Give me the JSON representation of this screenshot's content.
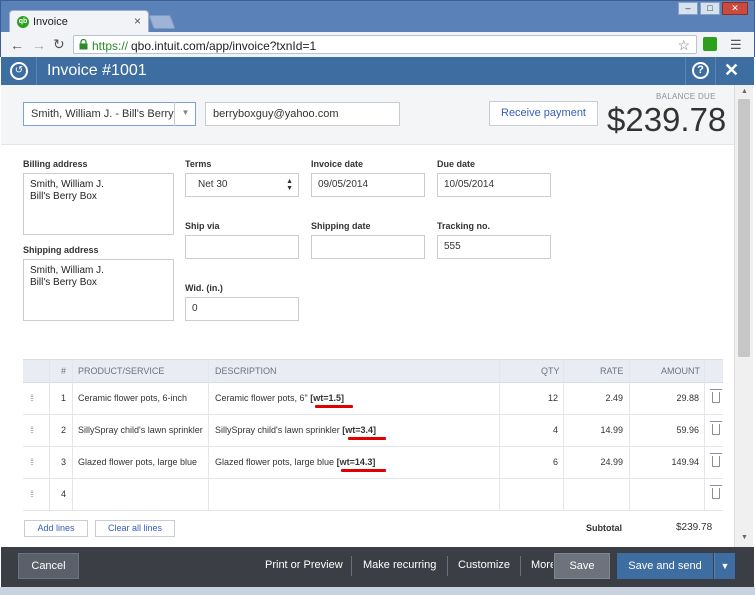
{
  "browser": {
    "tab_title": "Invoice",
    "tab_close": "×",
    "url_scheme": "https://",
    "url_rest": "qbo.intuit.com/app/invoice?txnId=1"
  },
  "header": {
    "title": "Invoice #1001",
    "help": "?",
    "close": "✕"
  },
  "customer": {
    "name": "Smith, William J. - Bill's Berry",
    "email": "berryboxguy@yahoo.com"
  },
  "receive_payment_label": "Receive payment",
  "balance": {
    "label": "BALANCE DUE",
    "amount": "$239.78"
  },
  "billing": {
    "label": "Billing address",
    "line1": "Smith, William J.",
    "line2": "Bill's Berry Box"
  },
  "shipping": {
    "label": "Shipping address",
    "line1": "Smith, William J.",
    "line2": "Bill's Berry Box"
  },
  "fields": {
    "terms_label": "Terms",
    "terms_value": "Net 30",
    "invoice_date_label": "Invoice date",
    "invoice_date": "09/05/2014",
    "due_date_label": "Due date",
    "due_date": "10/05/2014",
    "ship_via_label": "Ship via",
    "ship_via": "",
    "shipping_date_label": "Shipping date",
    "shipping_date": "",
    "tracking_label": "Tracking no.",
    "tracking": "555",
    "wid_label": "Wid. (in.)",
    "wid": "0"
  },
  "table": {
    "headers": [
      "#",
      "PRODUCT/SERVICE",
      "DESCRIPTION",
      "QTY",
      "RATE",
      "AMOUNT"
    ],
    "rows": [
      {
        "num": "1",
        "product": "Ceramic flower pots, 6-inch",
        "desc": "Ceramic flower pots, 6\"",
        "tag": "[wt=1.5]",
        "qty": "12",
        "rate": "2.49",
        "amount": "29.88"
      },
      {
        "num": "2",
        "product": "SillySpray child's lawn sprinkler",
        "desc": "SillySpray child's lawn sprinkler",
        "tag": "[wt=3.4]",
        "qty": "4",
        "rate": "14.99",
        "amount": "59.96"
      },
      {
        "num": "3",
        "product": "Glazed flower pots, large blue",
        "desc": "Glazed flower pots, large blue",
        "tag": "[wt=14.3]",
        "qty": "6",
        "rate": "24.99",
        "amount": "149.94"
      },
      {
        "num": "4",
        "product": "",
        "desc": "",
        "tag": "",
        "qty": "",
        "rate": "",
        "amount": ""
      }
    ]
  },
  "add_lines_label": "Add lines",
  "clear_lines_label": "Clear all lines",
  "subtotal": {
    "label": "Subtotal",
    "value": "$239.78"
  },
  "footer": {
    "cancel": "Cancel",
    "print": "Print or Preview",
    "recurring": "Make recurring",
    "customize": "Customize",
    "more": "More",
    "save": "Save",
    "save_send": "Save and send"
  },
  "colors": {
    "header_blue": "#3e6ea1",
    "footer_dark": "#3b3f45",
    "highlight_red": "#e00000",
    "link_blue": "#365ebf"
  }
}
